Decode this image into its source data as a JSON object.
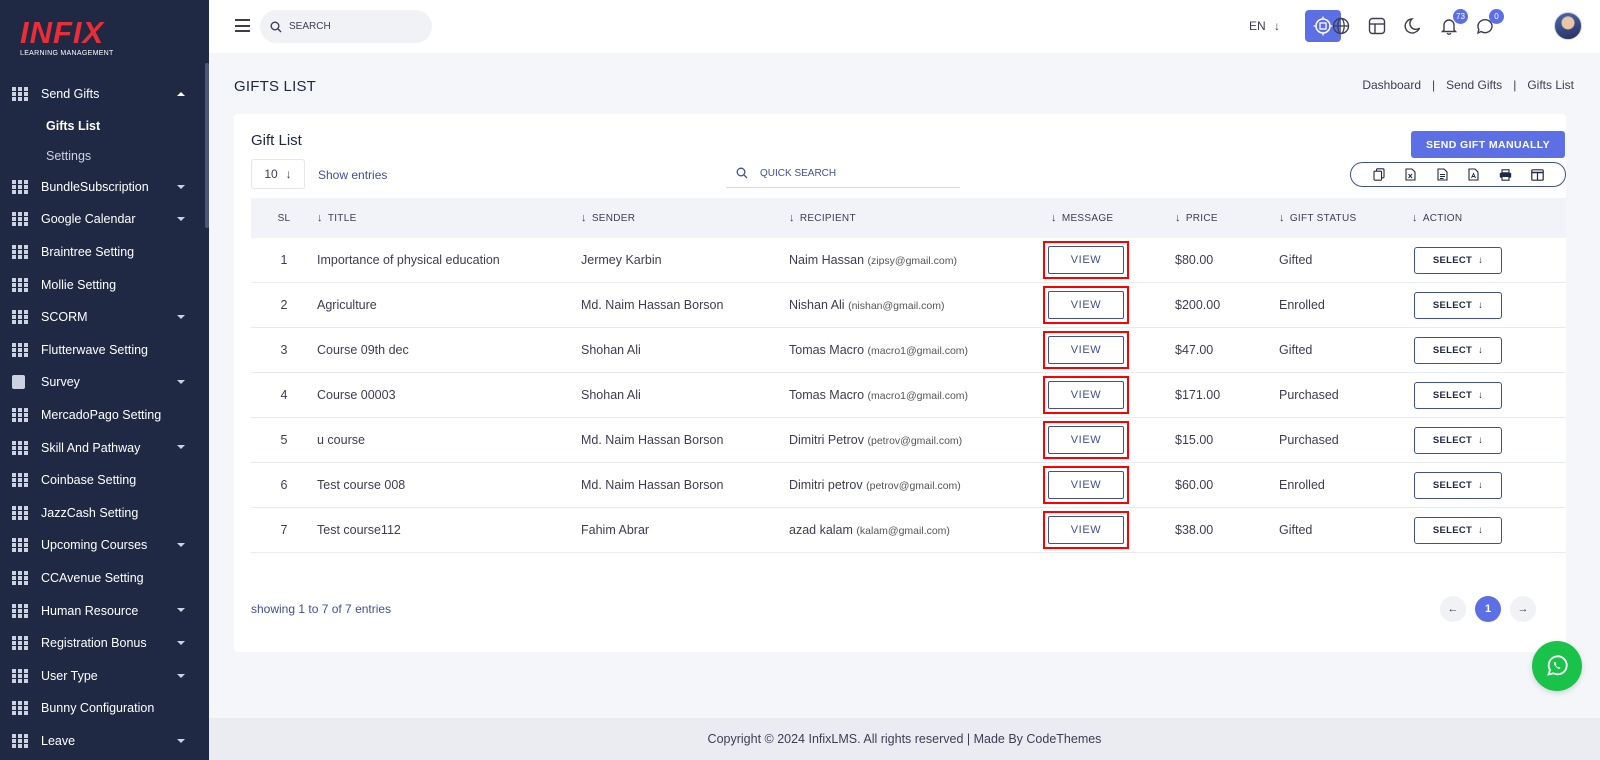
{
  "brand": {
    "logo": "INFIX",
    "tagline": "LEARNING MANAGEMENT",
    "accent": "#5c6fe5",
    "logo_color": "#ea2d37",
    "sidebar_bg": "#202944"
  },
  "sidebar": {
    "items": [
      {
        "label": "Send Gifts",
        "icon": "grid-icon",
        "expanded": true,
        "children": [
          {
            "label": "Gifts List",
            "active": true
          },
          {
            "label": "Settings",
            "active": false
          }
        ]
      },
      {
        "label": "BundleSubscription",
        "icon": "grid-icon",
        "dropdown": true
      },
      {
        "label": "Google Calendar",
        "icon": "grid-icon",
        "dropdown": true
      },
      {
        "label": "Braintree Setting",
        "icon": "grid-icon",
        "dropdown": false
      },
      {
        "label": "Mollie Setting",
        "icon": "grid-icon",
        "dropdown": false
      },
      {
        "label": "SCORM",
        "icon": "grid-icon",
        "dropdown": true
      },
      {
        "label": "Flutterwave Setting",
        "icon": "grid-icon",
        "dropdown": false
      },
      {
        "label": "Survey",
        "icon": "survey-icon",
        "dropdown": true
      },
      {
        "label": "MercadoPago Setting",
        "icon": "grid-icon",
        "dropdown": false
      },
      {
        "label": "Skill And Pathway",
        "icon": "grid-icon",
        "dropdown": true
      },
      {
        "label": "Coinbase Setting",
        "icon": "grid-icon",
        "dropdown": false
      },
      {
        "label": "JazzCash Setting",
        "icon": "grid-icon",
        "dropdown": false
      },
      {
        "label": "Upcoming Courses",
        "icon": "grid-icon",
        "dropdown": true
      },
      {
        "label": "CCAvenue Setting",
        "icon": "grid-icon",
        "dropdown": false
      },
      {
        "label": "Human Resource",
        "icon": "grid-icon",
        "dropdown": true
      },
      {
        "label": "Registration Bonus",
        "icon": "grid-icon",
        "dropdown": true
      },
      {
        "label": "User Type",
        "icon": "grid-icon",
        "dropdown": true
      },
      {
        "label": "Bunny Configuration",
        "icon": "grid-icon",
        "dropdown": false
      },
      {
        "label": "Leave",
        "icon": "grid-icon",
        "dropdown": true
      }
    ]
  },
  "header": {
    "search_placeholder": "SEARCH",
    "language": "EN",
    "notifications_count": "73",
    "messages_count": "0"
  },
  "page": {
    "title": "GIFTS LIST",
    "breadcrumb": [
      "Dashboard",
      "Send Gifts",
      "Gifts List"
    ]
  },
  "card": {
    "title": "Gift List",
    "send_button": "SEND GIFT MANUALLY",
    "entries_value": "10",
    "entries_label": "Show entries",
    "quick_search_placeholder": "QUICK SEARCH",
    "export_icons": [
      "copy-icon",
      "excel-icon",
      "csv-icon",
      "pdf-icon",
      "print-icon",
      "columns-icon"
    ]
  },
  "table": {
    "columns": [
      "SL",
      "TITLE",
      "SENDER",
      "RECIPIENT",
      "MESSAGE",
      "PRICE",
      "GIFT STATUS",
      "ACTION"
    ],
    "view_label": "VIEW",
    "select_label": "SELECT",
    "rows": [
      {
        "sl": "1",
        "title": "Importance of physical education",
        "sender": "Jermey Karbin",
        "recipient": "Naim Hassan",
        "email": "(zipsy@gmail.com)",
        "price": "$80.00",
        "status": "Gifted"
      },
      {
        "sl": "2",
        "title": "Agriculture",
        "sender": "Md. Naim Hassan Borson",
        "recipient": "Nishan Ali",
        "email": "(nishan@gmail.com)",
        "price": "$200.00",
        "status": "Enrolled"
      },
      {
        "sl": "3",
        "title": "Course 09th dec",
        "sender": "Shohan Ali",
        "recipient": "Tomas Macro",
        "email": "(macro1@gmail.com)",
        "price": "$47.00",
        "status": "Gifted"
      },
      {
        "sl": "4",
        "title": "Course 00003",
        "sender": "Shohan Ali",
        "recipient": "Tomas Macro",
        "email": "(macro1@gmail.com)",
        "price": "$171.00",
        "status": "Purchased"
      },
      {
        "sl": "5",
        "title": "u course",
        "sender": "Md. Naim Hassan Borson",
        "recipient": "Dimitri Petrov",
        "email": "(petrov@gmail.com)",
        "price": "$15.00",
        "status": "Purchased"
      },
      {
        "sl": "6",
        "title": "Test course 008",
        "sender": "Md. Naim Hassan Borson",
        "recipient": "Dimitri petrov",
        "email": "(petrov@gmail.com)",
        "price": "$60.00",
        "status": "Enrolled"
      },
      {
        "sl": "7",
        "title": "Test course112",
        "sender": "Fahim Abrar",
        "recipient": "azad kalam",
        "email": "(kalam@gmail.com)",
        "price": "$38.00",
        "status": "Gifted"
      }
    ]
  },
  "pagination": {
    "summary": "showing 1 to 7 of 7 entries",
    "current": "1"
  },
  "footer": {
    "text": "Copyright © 2024 InfixLMS. All rights reserved | Made By CodeThemes"
  }
}
